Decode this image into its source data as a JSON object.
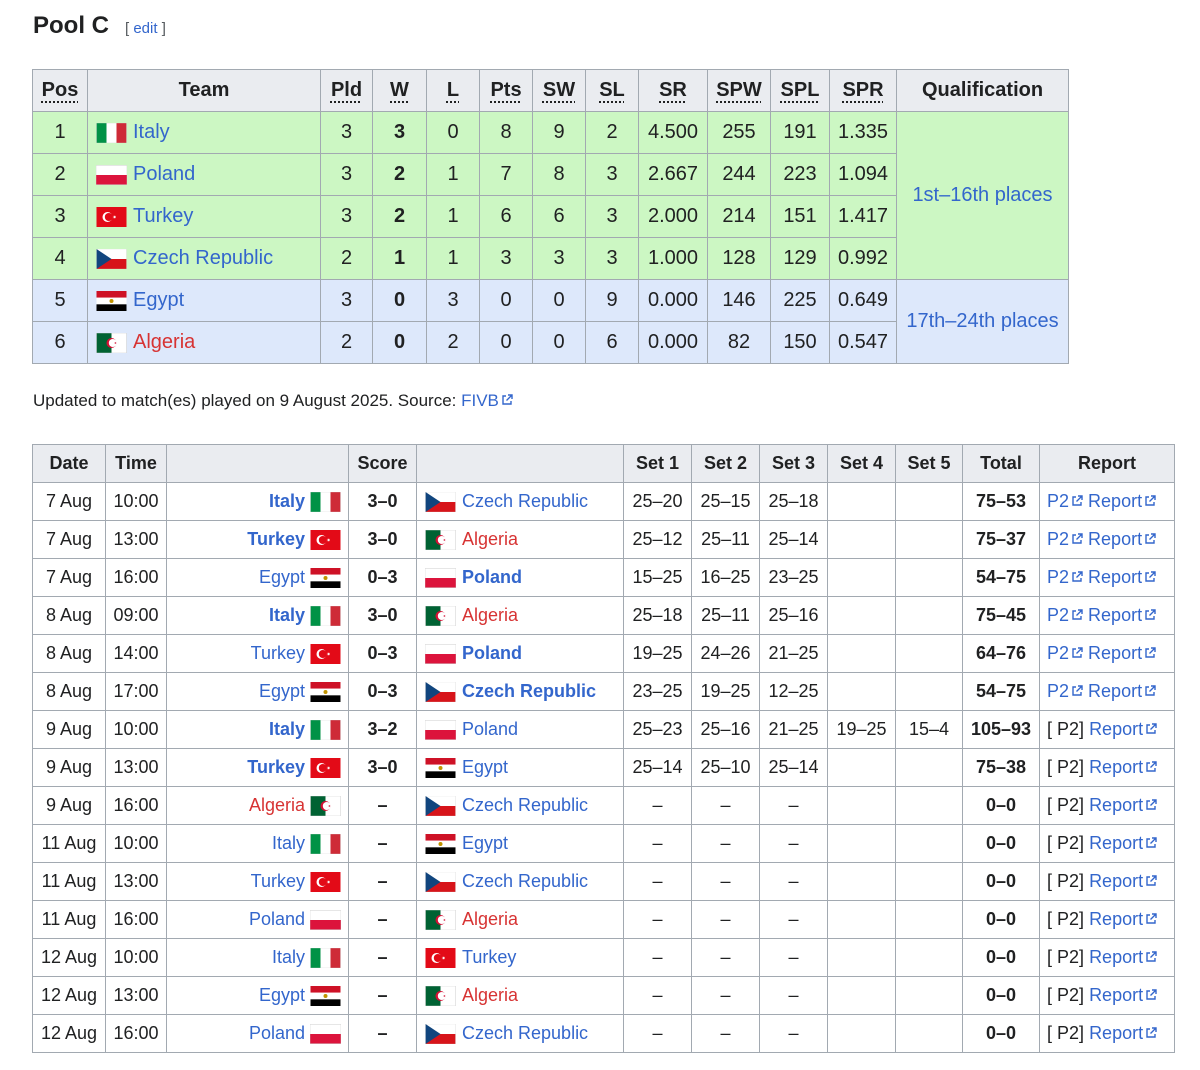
{
  "heading": {
    "title": "Pool C",
    "edit_open": "[ ",
    "edit_label": "edit",
    "edit_close": " ]"
  },
  "standings": {
    "headers": {
      "pos": "Pos",
      "team": "Team",
      "pld": "Pld",
      "w": "W",
      "l": "L",
      "pts": "Pts",
      "sw": "SW",
      "sl": "SL",
      "sr": "SR",
      "spw": "SPW",
      "spl": "SPL",
      "spr": "SPR",
      "qualification": "Qualification"
    },
    "rows": [
      {
        "pos": "1",
        "team": "Italy",
        "flag": "italy",
        "pld": "3",
        "w": "3",
        "l": "0",
        "pts": "8",
        "sw": "9",
        "sl": "2",
        "sr": "4.500",
        "spw": "255",
        "spl": "191",
        "spr": "1.335"
      },
      {
        "pos": "2",
        "team": "Poland",
        "flag": "poland",
        "pld": "3",
        "w": "2",
        "l": "1",
        "pts": "7",
        "sw": "8",
        "sl": "3",
        "sr": "2.667",
        "spw": "244",
        "spl": "223",
        "spr": "1.094"
      },
      {
        "pos": "3",
        "team": "Turkey",
        "flag": "turkey",
        "pld": "3",
        "w": "2",
        "l": "1",
        "pts": "6",
        "sw": "6",
        "sl": "3",
        "sr": "2.000",
        "spw": "214",
        "spl": "151",
        "spr": "1.417"
      },
      {
        "pos": "4",
        "team": "Czech Republic",
        "flag": "czech",
        "pld": "2",
        "w": "1",
        "l": "1",
        "pts": "3",
        "sw": "3",
        "sl": "3",
        "sr": "1.000",
        "spw": "128",
        "spl": "129",
        "spr": "0.992"
      },
      {
        "pos": "5",
        "team": "Egypt",
        "flag": "egypt",
        "pld": "3",
        "w": "0",
        "l": "3",
        "pts": "0",
        "sw": "0",
        "sl": "9",
        "sr": "0.000",
        "spw": "146",
        "spl": "225",
        "spr": "0.649"
      },
      {
        "pos": "6",
        "team": "Algeria",
        "flag": "algeria",
        "pld": "2",
        "w": "0",
        "l": "2",
        "pts": "0",
        "sw": "0",
        "sl": "6",
        "sr": "0.000",
        "spw": "82",
        "spl": "150",
        "spr": "0.547"
      }
    ],
    "qualification": [
      "1st–16th places",
      "17th–24th places"
    ],
    "colors": {
      "green": "#ccf7c3",
      "blue": "#dde8fb",
      "header": "#eaecf0",
      "border": "#a2a9b1",
      "link": "#3366cc",
      "red_link": "#d73333"
    }
  },
  "note": {
    "text": "Updated to match(es) played on 9 August 2025. Source: ",
    "source_label": "FIVB"
  },
  "matches": {
    "headers": {
      "date": "Date",
      "time": "Time",
      "home": "",
      "score": "Score",
      "away": "",
      "set1": "Set 1",
      "set2": "Set 2",
      "set3": "Set 3",
      "set4": "Set 4",
      "set5": "Set 5",
      "total": "Total",
      "report": "Report"
    },
    "rows": [
      {
        "date": "7 Aug",
        "time": "10:00",
        "home": "Italy",
        "home_flag": "italy",
        "home_bold": true,
        "score": "3–0",
        "away": "Czech Republic",
        "away_flag": "czech",
        "away_bold": false,
        "sets": [
          "25–20",
          "25–15",
          "25–18",
          "",
          ""
        ],
        "total": "75–53",
        "p2": "P2",
        "bracket": false,
        "report": "Report"
      },
      {
        "date": "7 Aug",
        "time": "13:00",
        "home": "Turkey",
        "home_flag": "turkey",
        "home_bold": true,
        "score": "3–0",
        "away": "Algeria",
        "away_flag": "algeria",
        "away_bold": false,
        "sets": [
          "25–12",
          "25–11",
          "25–14",
          "",
          ""
        ],
        "total": "75–37",
        "p2": "P2",
        "bracket": false,
        "report": "Report"
      },
      {
        "date": "7 Aug",
        "time": "16:00",
        "home": "Egypt",
        "home_flag": "egypt",
        "home_bold": false,
        "score": "0–3",
        "away": "Poland",
        "away_flag": "poland",
        "away_bold": true,
        "sets": [
          "15–25",
          "16–25",
          "23–25",
          "",
          ""
        ],
        "total": "54–75",
        "p2": "P2",
        "bracket": false,
        "report": "Report"
      },
      {
        "date": "8 Aug",
        "time": "09:00",
        "home": "Italy",
        "home_flag": "italy",
        "home_bold": true,
        "score": "3–0",
        "away": "Algeria",
        "away_flag": "algeria",
        "away_bold": false,
        "sets": [
          "25–18",
          "25–11",
          "25–16",
          "",
          ""
        ],
        "total": "75–45",
        "p2": "P2",
        "bracket": false,
        "report": "Report"
      },
      {
        "date": "8 Aug",
        "time": "14:00",
        "home": "Turkey",
        "home_flag": "turkey",
        "home_bold": false,
        "score": "0–3",
        "away": "Poland",
        "away_flag": "poland",
        "away_bold": true,
        "sets": [
          "19–25",
          "24–26",
          "21–25",
          "",
          ""
        ],
        "total": "64–76",
        "p2": "P2",
        "bracket": false,
        "report": "Report"
      },
      {
        "date": "8 Aug",
        "time": "17:00",
        "home": "Egypt",
        "home_flag": "egypt",
        "home_bold": false,
        "score": "0–3",
        "away": "Czech Republic",
        "away_flag": "czech",
        "away_bold": true,
        "sets": [
          "23–25",
          "19–25",
          "12–25",
          "",
          ""
        ],
        "total": "54–75",
        "p2": "P2",
        "bracket": false,
        "report": "Report"
      },
      {
        "date": "9 Aug",
        "time": "10:00",
        "home": "Italy",
        "home_flag": "italy",
        "home_bold": true,
        "score": "3–2",
        "away": "Poland",
        "away_flag": "poland",
        "away_bold": false,
        "sets": [
          "25–23",
          "25–16",
          "21–25",
          "19–25",
          "15–4"
        ],
        "total": "105–93",
        "p2": "P2",
        "bracket": true,
        "report": "Report"
      },
      {
        "date": "9 Aug",
        "time": "13:00",
        "home": "Turkey",
        "home_flag": "turkey",
        "home_bold": true,
        "score": "3–0",
        "away": "Egypt",
        "away_flag": "egypt",
        "away_bold": false,
        "sets": [
          "25–14",
          "25–10",
          "25–14",
          "",
          ""
        ],
        "total": "75–38",
        "p2": "P2",
        "bracket": true,
        "report": "Report"
      },
      {
        "date": "9 Aug",
        "time": "16:00",
        "home": "Algeria",
        "home_flag": "algeria",
        "home_bold": false,
        "score": "–",
        "away": "Czech Republic",
        "away_flag": "czech",
        "away_bold": false,
        "sets": [
          "–",
          "–",
          "–",
          "",
          ""
        ],
        "total": "0–0",
        "p2": "P2",
        "bracket": true,
        "report": "Report"
      },
      {
        "date": "11 Aug",
        "time": "10:00",
        "home": "Italy",
        "home_flag": "italy",
        "home_bold": false,
        "score": "–",
        "away": "Egypt",
        "away_flag": "egypt",
        "away_bold": false,
        "sets": [
          "–",
          "–",
          "–",
          "",
          ""
        ],
        "total": "0–0",
        "p2": "P2",
        "bracket": true,
        "report": "Report"
      },
      {
        "date": "11 Aug",
        "time": "13:00",
        "home": "Turkey",
        "home_flag": "turkey",
        "home_bold": false,
        "score": "–",
        "away": "Czech Republic",
        "away_flag": "czech",
        "away_bold": false,
        "sets": [
          "–",
          "–",
          "–",
          "",
          ""
        ],
        "total": "0–0",
        "p2": "P2",
        "bracket": true,
        "report": "Report"
      },
      {
        "date": "11 Aug",
        "time": "16:00",
        "home": "Poland",
        "home_flag": "poland",
        "home_bold": false,
        "score": "–",
        "away": "Algeria",
        "away_flag": "algeria",
        "away_bold": false,
        "sets": [
          "–",
          "–",
          "–",
          "",
          ""
        ],
        "total": "0–0",
        "p2": "P2",
        "bracket": true,
        "report": "Report"
      },
      {
        "date": "12 Aug",
        "time": "10:00",
        "home": "Italy",
        "home_flag": "italy",
        "home_bold": false,
        "score": "–",
        "away": "Turkey",
        "away_flag": "turkey",
        "away_bold": false,
        "sets": [
          "–",
          "–",
          "–",
          "",
          ""
        ],
        "total": "0–0",
        "p2": "P2",
        "bracket": true,
        "report": "Report"
      },
      {
        "date": "12 Aug",
        "time": "13:00",
        "home": "Egypt",
        "home_flag": "egypt",
        "home_bold": false,
        "score": "–",
        "away": "Algeria",
        "away_flag": "algeria",
        "away_bold": false,
        "sets": [
          "–",
          "–",
          "–",
          "",
          ""
        ],
        "total": "0–0",
        "p2": "P2",
        "bracket": true,
        "report": "Report"
      },
      {
        "date": "12 Aug",
        "time": "16:00",
        "home": "Poland",
        "home_flag": "poland",
        "home_bold": false,
        "score": "–",
        "away": "Czech Republic",
        "away_flag": "czech",
        "away_bold": false,
        "sets": [
          "–",
          "–",
          "–",
          "",
          ""
        ],
        "total": "0–0",
        "p2": "P2",
        "bracket": true,
        "report": "Report"
      }
    ]
  }
}
